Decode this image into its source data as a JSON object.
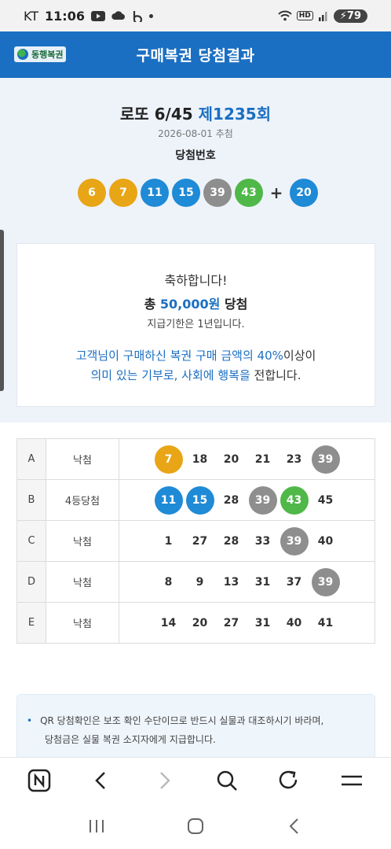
{
  "status_bar": {
    "carrier": "KT",
    "time": "11:06",
    "battery": "79",
    "hd_badge": "HD",
    "icons": [
      "youtube-icon",
      "cloud-icon",
      "b-app-icon",
      "dot-icon",
      "wifi-icon",
      "signal-icon",
      "battery-icon"
    ]
  },
  "header": {
    "logo_text": "동행복권",
    "title": "구매복권 당첨결과"
  },
  "summary": {
    "game_name": "로또 6/45",
    "round": "제1235회",
    "draw_date": "2026-08-01 추첨",
    "win_label": "당첨번호",
    "winning_numbers": [
      {
        "value": "6",
        "color": "#e8a516"
      },
      {
        "value": "7",
        "color": "#e8a516"
      },
      {
        "value": "11",
        "color": "#1f8ad6"
      },
      {
        "value": "15",
        "color": "#1f8ad6"
      },
      {
        "value": "39",
        "color": "#8e8e8e"
      },
      {
        "value": "43",
        "color": "#4fb848"
      }
    ],
    "plus": "+",
    "bonus_number": {
      "value": "20",
      "color": "#1f8ad6"
    }
  },
  "congrats": {
    "line1": "축하합니다!",
    "line2_prefix": "총 ",
    "line2_amount": "50,000원",
    "line2_suffix": " 당첨",
    "line3": "지급기한은 1년입니다.",
    "line4_a": "고객님이 구매하신 복권 구매 금액의 40%",
    "line4_b": "이상이",
    "line5_a": "의미 있는 기부로, 사회에 행복을",
    "line5_b": " 전합니다."
  },
  "results": [
    {
      "game": "A",
      "result": "낙첨",
      "numbers": [
        {
          "v": "7",
          "c": "yellow"
        },
        {
          "v": "18",
          "c": ""
        },
        {
          "v": "20",
          "c": ""
        },
        {
          "v": "21",
          "c": ""
        },
        {
          "v": "23",
          "c": ""
        },
        {
          "v": "39",
          "c": "gray"
        }
      ]
    },
    {
      "game": "B",
      "result": "4등당첨",
      "numbers": [
        {
          "v": "11",
          "c": "blue"
        },
        {
          "v": "15",
          "c": "blue"
        },
        {
          "v": "28",
          "c": ""
        },
        {
          "v": "39",
          "c": "gray"
        },
        {
          "v": "43",
          "c": "green"
        },
        {
          "v": "45",
          "c": ""
        }
      ]
    },
    {
      "game": "C",
      "result": "낙첨",
      "numbers": [
        {
          "v": "1",
          "c": ""
        },
        {
          "v": "27",
          "c": ""
        },
        {
          "v": "28",
          "c": ""
        },
        {
          "v": "33",
          "c": ""
        },
        {
          "v": "39",
          "c": "gray"
        },
        {
          "v": "40",
          "c": ""
        }
      ]
    },
    {
      "game": "D",
      "result": "낙첨",
      "numbers": [
        {
          "v": "8",
          "c": ""
        },
        {
          "v": "9",
          "c": ""
        },
        {
          "v": "13",
          "c": ""
        },
        {
          "v": "31",
          "c": ""
        },
        {
          "v": "37",
          "c": ""
        },
        {
          "v": "39",
          "c": "gray"
        }
      ]
    },
    {
      "game": "E",
      "result": "낙첨",
      "numbers": [
        {
          "v": "14",
          "c": ""
        },
        {
          "v": "20",
          "c": ""
        },
        {
          "v": "27",
          "c": ""
        },
        {
          "v": "31",
          "c": ""
        },
        {
          "v": "40",
          "c": ""
        },
        {
          "v": "41",
          "c": ""
        }
      ]
    }
  ],
  "notice": {
    "bullet": "•",
    "line1": "QR 당첨확인은 보조 확인 수단이므로 반드시 실물과 대조하시기 바라며,",
    "line2": "당첨금은 실물 복권 소지자에게 지급합니다."
  },
  "browser_bar": {
    "buttons": [
      "naver-n-icon",
      "back-icon",
      "forward-icon",
      "search-icon",
      "refresh-icon",
      "menu-icon"
    ]
  },
  "nav_bar": {
    "buttons": [
      "recent-apps-icon",
      "home-icon",
      "system-back-icon"
    ]
  }
}
